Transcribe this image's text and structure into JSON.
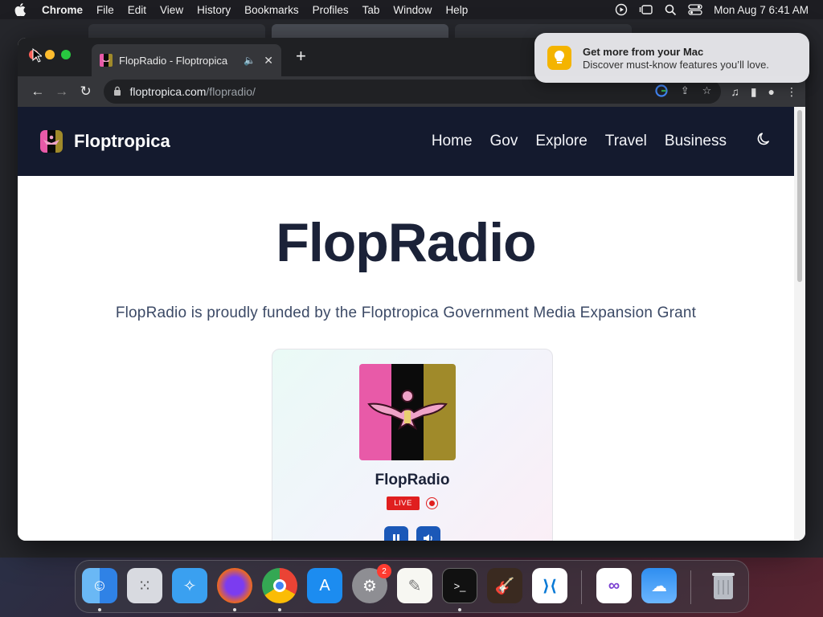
{
  "menubar": {
    "app": "Chrome",
    "items": [
      "File",
      "Edit",
      "View",
      "History",
      "Bookmarks",
      "Profiles",
      "Tab",
      "Window",
      "Help"
    ],
    "clock": "Mon Aug 7  6:41 AM"
  },
  "browser": {
    "tab_title": "FlopRadio - Floptropica",
    "new_tab": "+",
    "close_tab": "✕",
    "url_host": "floptropica.com",
    "url_path": "/flopradio/"
  },
  "notification": {
    "title": "Get more from your Mac",
    "body": "Discover must-know features you’ll love."
  },
  "site": {
    "brand": "Floptropica",
    "nav": [
      "Home",
      "Gov",
      "Explore",
      "Travel",
      "Business"
    ],
    "title": "FlopRadio",
    "subtitle": "FlopRadio is proudly funded by the Floptropica Government Media Expansion Grant"
  },
  "player": {
    "station": "FlopRadio",
    "live_label": "LIVE"
  },
  "dock": {
    "apps": [
      "Finder",
      "Launchpad",
      "Safari",
      "Firefox",
      "Chrome",
      "App Store",
      "System Settings",
      "TextEdit",
      "Terminal",
      "GarageBand",
      "Visual Studio Code",
      "Visual Studio",
      "Weather",
      "Trash"
    ],
    "settings_badge": "2"
  },
  "colors": {
    "site_header": "#141a2e",
    "live_red": "#e01f1f",
    "player_button": "#1b58b8"
  }
}
